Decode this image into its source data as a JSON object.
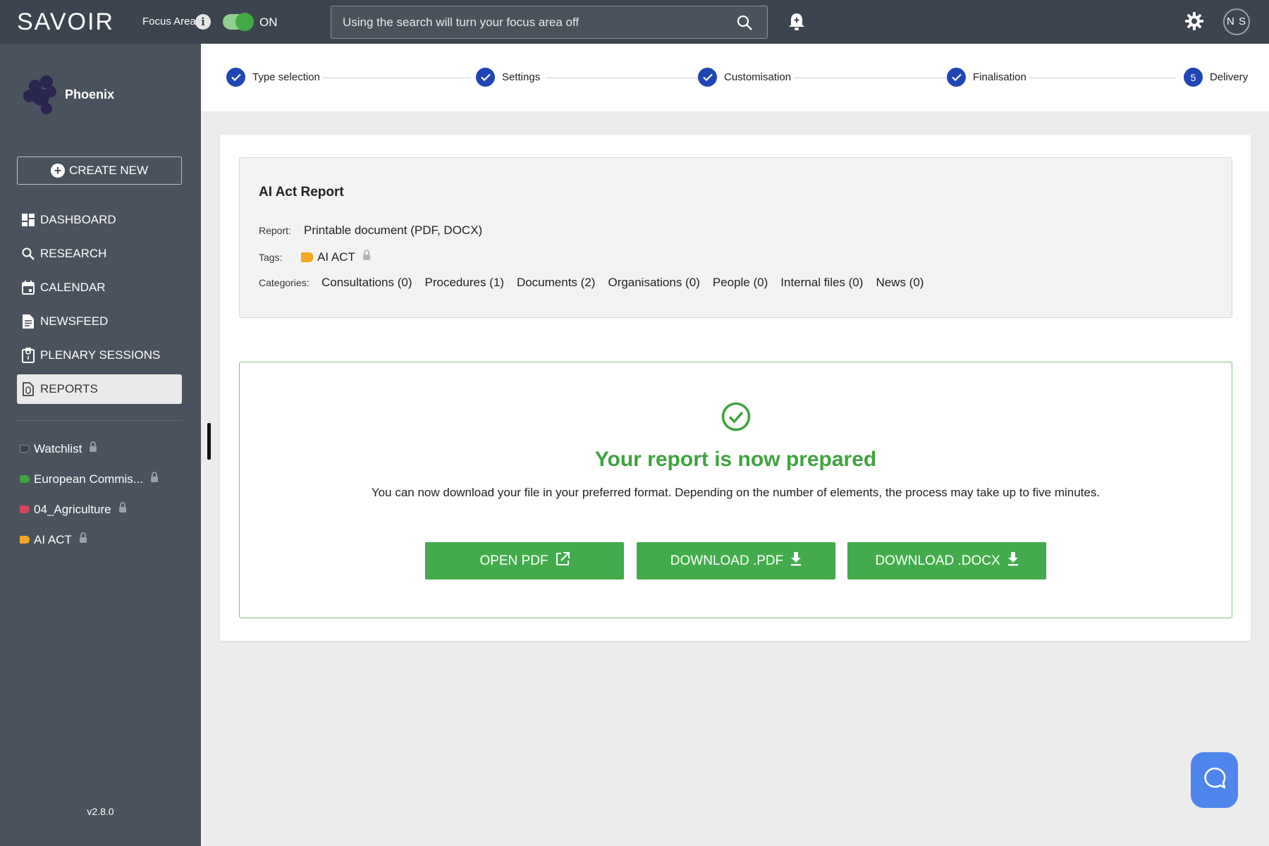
{
  "app": {
    "logo": "SAVOIR"
  },
  "topbar": {
    "focus_label": "Focus Area",
    "toggle_state": "ON",
    "search_placeholder": "Using the search will turn your focus area off",
    "avatar_initials": "N S"
  },
  "sidebar": {
    "brand_name": "Phoenix",
    "create_label": "CREATE NEW",
    "nav": [
      {
        "label": "DASHBOARD",
        "icon": "dashboard-icon"
      },
      {
        "label": "RESEARCH",
        "icon": "search-icon"
      },
      {
        "label": "CALENDAR",
        "icon": "calendar-icon"
      },
      {
        "label": "NEWSFEED",
        "icon": "newsfeed-icon"
      },
      {
        "label": "PLENARY SESSIONS",
        "icon": "clipboard-icon"
      },
      {
        "label": "REPORTS",
        "icon": "report-icon",
        "active": true
      }
    ],
    "tags": [
      {
        "label": "Watchlist",
        "color": "#3a3f46"
      },
      {
        "label": "European Commis...",
        "color": "#3fa33f"
      },
      {
        "label": "04_Agriculture",
        "color": "#d2475f"
      },
      {
        "label": "AI ACT",
        "color": "#f5a623"
      }
    ],
    "version": "v2.8.0"
  },
  "stepper": [
    {
      "label": "Type selection",
      "state": "done"
    },
    {
      "label": "Settings",
      "state": "done"
    },
    {
      "label": "Customisation",
      "state": "done"
    },
    {
      "label": "Finalisation",
      "state": "done"
    },
    {
      "label": "Delivery",
      "state": "current",
      "number": "5"
    }
  ],
  "summary": {
    "title": "AI Act Report",
    "report_label": "Report:",
    "report_value": "Printable document (PDF, DOCX)",
    "tags_label": "Tags:",
    "tag_value": "AI ACT",
    "tag_color": "#f5a623",
    "categories_label": "Categories:",
    "categories": [
      "Consultations (0)",
      "Procedures (1)",
      "Documents (2)",
      "Organisations (0)",
      "People (0)",
      "Internal files (0)",
      "News (0)"
    ]
  },
  "result": {
    "title": "Your report is now prepared",
    "description": "You can now download your file in your preferred format. Depending on the number of elements, the process may take up to five minutes.",
    "buttons": [
      {
        "label": "OPEN PDF",
        "icon": "external-link-icon"
      },
      {
        "label": "DOWNLOAD .PDF",
        "icon": "download-icon"
      },
      {
        "label": "DOWNLOAD .DOCX",
        "icon": "download-icon"
      }
    ]
  },
  "colors": {
    "accent": "#43ab4b",
    "step": "#1f46b5",
    "sidebar": "#4a525d",
    "topbar": "#3c444f"
  }
}
